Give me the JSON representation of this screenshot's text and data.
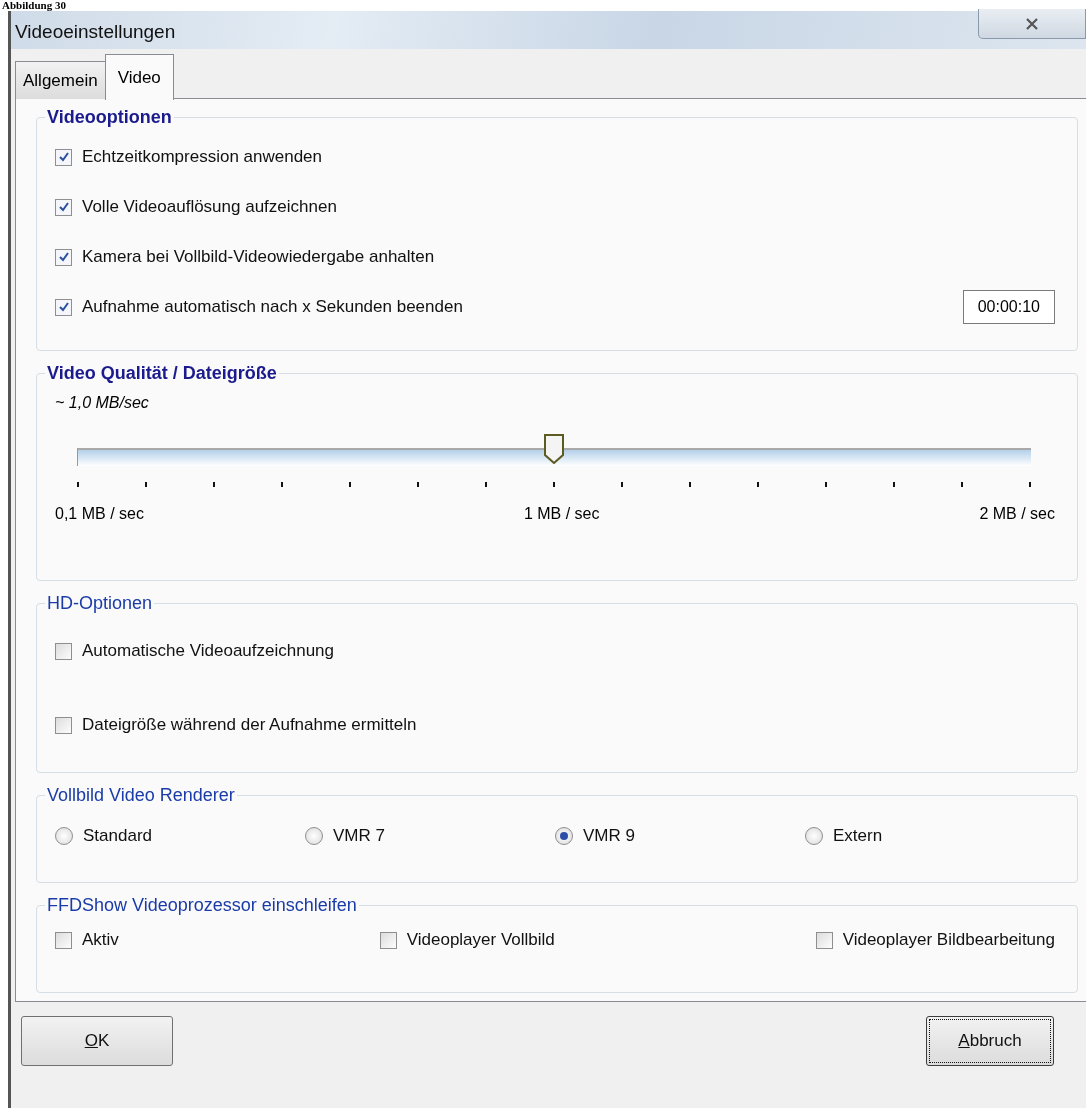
{
  "caption": "Abbildung 30",
  "window": {
    "title": "Videoeinstellungen"
  },
  "tabs": [
    {
      "label": "Allgemein",
      "selected": false
    },
    {
      "label": "Video",
      "selected": true
    }
  ],
  "video_options": {
    "title": "Videooptionen",
    "emphasized": true,
    "items": [
      {
        "label": "Echtzeitkompression anwenden",
        "checked": true
      },
      {
        "label": "Volle Videoauflösung aufzeichnen",
        "checked": true
      },
      {
        "label": "Kamera bei Vollbild-Videowiedergabe anhalten",
        "checked": true
      },
      {
        "label": "Aufnahme automatisch nach x Sekunden beenden",
        "checked": true,
        "value": "00:00:10"
      }
    ]
  },
  "quality": {
    "title": "Video Qualität / Dateigröße",
    "emphasized": true,
    "reading": "~ 1,0 MB/sec",
    "level": 0.5,
    "scale_labels": [
      "0,1 MB / sec",
      "1 MB / sec",
      "2 MB / sec"
    ]
  },
  "hd_options": {
    "title": "HD-Optionen",
    "emphasized": false,
    "items": [
      {
        "label": "Automatische Videoaufzeichnung",
        "checked": false
      },
      {
        "label": "Dateigröße während der Aufnahme ermitteln",
        "checked": false
      }
    ]
  },
  "renderer": {
    "title": "Vollbild Video Renderer",
    "emphasized": false,
    "options": [
      {
        "label": "Standard",
        "selected": false
      },
      {
        "label": "VMR 7",
        "selected": false
      },
      {
        "label": "VMR 9",
        "selected": true
      },
      {
        "label": "Extern",
        "selected": false
      }
    ]
  },
  "ffdshow": {
    "title": "FFDShow Videoprozessor einschleifen",
    "emphasized": false,
    "items": [
      {
        "label": "Aktiv",
        "checked": false
      },
      {
        "label": "Videoplayer Vollbild",
        "checked": false
      },
      {
        "label": "Videoplayer Bildbearbeitung",
        "checked": false
      }
    ]
  },
  "buttons": [
    {
      "label": "OK",
      "focused": false
    },
    {
      "label": "Abbruch",
      "focused": true
    }
  ]
}
